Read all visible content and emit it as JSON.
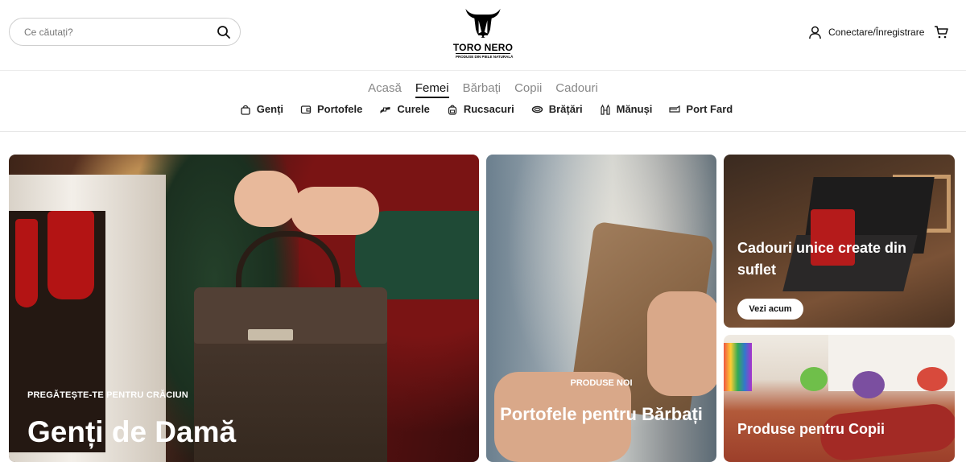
{
  "header": {
    "search": {
      "placeholder": "Ce căutați?"
    },
    "logo": {
      "brand": "TORO NERO",
      "tagline": "PRODUSE DIN PIELE NATURALĂ"
    },
    "account": {
      "label": "Conectare/Înregistrare"
    },
    "icons": {
      "search": "search-icon",
      "account": "user-icon",
      "cart": "cart-icon"
    }
  },
  "nav": {
    "top": [
      {
        "label": "Acasă",
        "active": false
      },
      {
        "label": "Femei",
        "active": true
      },
      {
        "label": "Bărbați",
        "active": false
      },
      {
        "label": "Copii",
        "active": false
      },
      {
        "label": "Cadouri",
        "active": false
      }
    ],
    "sub": [
      {
        "label": "Genți",
        "icon": "bag-icon"
      },
      {
        "label": "Portofele",
        "icon": "wallet-icon"
      },
      {
        "label": "Curele",
        "icon": "belt-icon"
      },
      {
        "label": "Rucsacuri",
        "icon": "backpack-icon"
      },
      {
        "label": "Brățări",
        "icon": "bracelet-icon"
      },
      {
        "label": "Mănuși",
        "icon": "gloves-icon"
      },
      {
        "label": "Port Fard",
        "icon": "makeup-case-icon"
      }
    ]
  },
  "tiles": {
    "main": {
      "kicker": "PREGĂTEȘTE-TE PENTRU CRĂCIUN",
      "title": "Genți de Damă"
    },
    "wallets": {
      "kicker": "PRODUSE NOI",
      "title": "Portofele pentru Bărbați"
    },
    "gifts": {
      "title": "Cadouri unice create din suflet",
      "button": "Vezi acum"
    },
    "kids": {
      "title": "Produse pentru Copii"
    }
  },
  "colors": {
    "text": "#111111",
    "muted": "#888888",
    "border": "#e6e6e6",
    "white": "#ffffff"
  }
}
